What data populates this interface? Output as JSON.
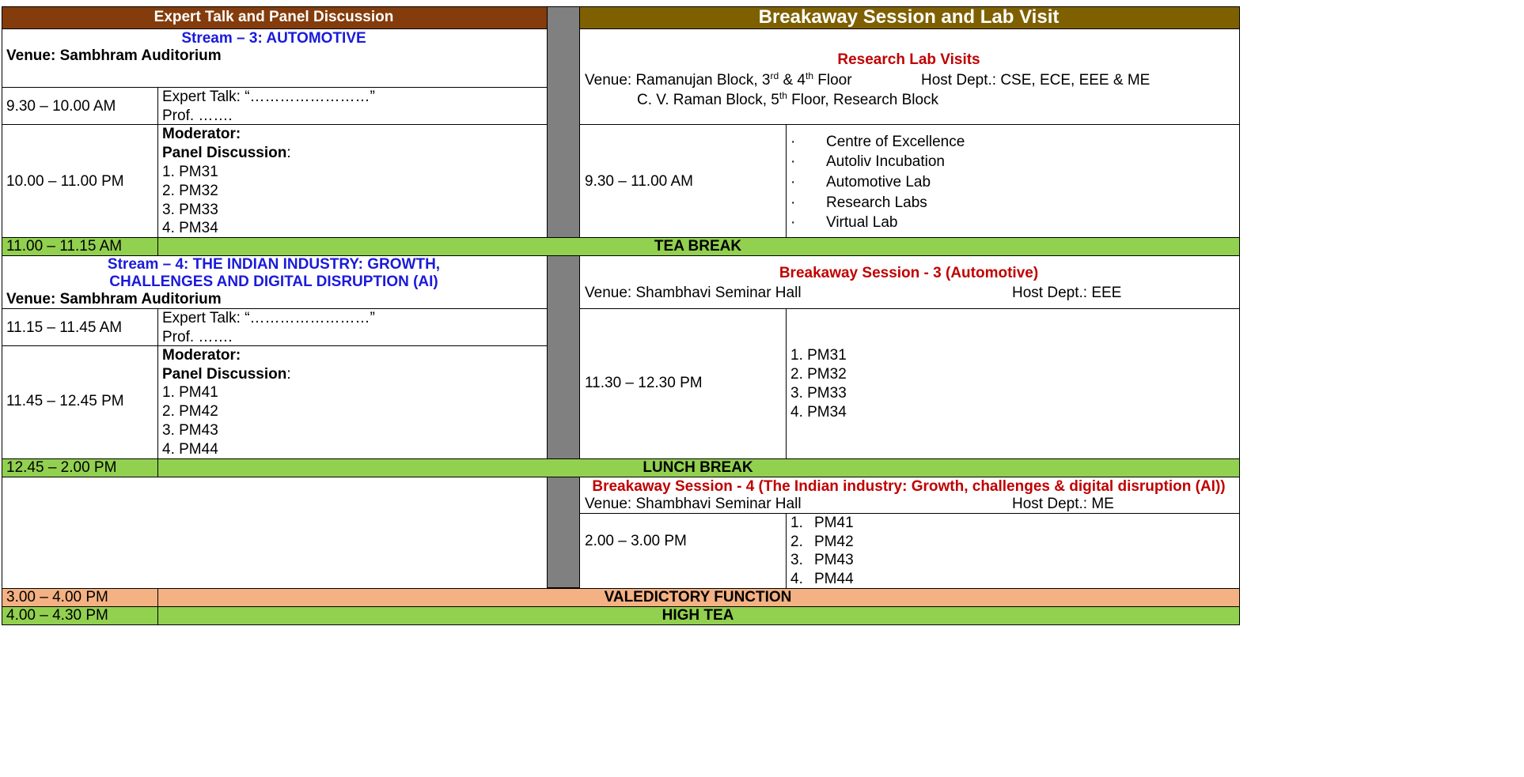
{
  "colors": {
    "left_header_bg": "#843c0c",
    "right_header_bg": "#7f6000",
    "divider_gray": "#808080",
    "break_green": "#92d050",
    "valedictory_orange": "#f4b183",
    "stream_blue": "#1a1adb",
    "session_red": "#c00000"
  },
  "header": {
    "left": "Expert Talk and Panel Discussion",
    "right": "Breakaway Session and Lab Visit"
  },
  "stream3": {
    "title": "Stream – 3: AUTOMOTIVE",
    "venue": "Venue: Sambhram Auditorium",
    "talk_time": "9.30 – 10.00 AM",
    "talk_title": "Expert Talk: “……………………”",
    "talk_prof": "Prof. …….",
    "panel_time": "10.00 – 11.00 PM",
    "moderator": "Moderator:",
    "panel_label": "Panel Discussion",
    "panel_colon": ":",
    "panelists": [
      "1. PM31",
      "2. PM32",
      "3. PM33",
      "4. PM34"
    ]
  },
  "lab_visits": {
    "title": "Research Lab Visits",
    "venue_prefix": "Venue:  Ramanujan Block, 3",
    "sup1": "rd",
    "amp": " & 4",
    "sup2": "th",
    "floor": " Floor",
    "host": "Host Dept.: CSE, ECE, EEE & ME",
    "line2_a": "C. V. Raman Block, 5",
    "line2_sup": "th",
    "line2_b": " Floor, Research Block",
    "time": "9.30 – 11.00 AM",
    "bullet": "·",
    "labs": [
      "Centre of Excellence",
      "Autoliv Incubation",
      "Automotive Lab",
      "Research Labs",
      "Virtual Lab"
    ]
  },
  "tea_break": {
    "time": "11.00 – 11.15 AM",
    "label": "TEA BREAK"
  },
  "stream4": {
    "title_line1": "Stream – 4: THE INDIAN INDUSTRY: GROWTH,",
    "title_line2": "CHALLENGES AND DIGITAL DISRUPTION (AI)",
    "venue": "Venue: Sambhram Auditorium",
    "talk_time": "11.15 – 11.45 AM",
    "talk_title": "Expert Talk: “……………………”",
    "talk_prof": "Prof. …….",
    "panel_time": "11.45 – 12.45 PM",
    "moderator": "Moderator:",
    "panel_label": "Panel Discussion",
    "panel_colon": ":",
    "panelists": [
      "1. PM41",
      "2. PM42",
      "3. PM43",
      "4. PM44"
    ]
  },
  "session3": {
    "title": "Breakaway Session - 3 (Automotive)",
    "venue": "Venue: Shambhavi  Seminar Hall",
    "host": "Host Dept.: EEE",
    "time": "11.30 – 12.30 PM",
    "items": [
      "1. PM31",
      "2. PM32",
      "3. PM33",
      "4. PM34"
    ]
  },
  "lunch_break": {
    "time": "12.45 – 2.00 PM",
    "label": "LUNCH BREAK"
  },
  "session4": {
    "title": "Breakaway Session - 4 (The Indian industry: Growth, challenges & digital disruption (AI))",
    "venue": "Venue: Shambhavi  Seminar Hall",
    "host": "Host Dept.: ME",
    "time": "2.00 – 3.00 PM",
    "item_numbers": [
      "1.",
      "2.",
      "3.",
      "4."
    ],
    "item_names": [
      "PM41",
      "PM42",
      "PM43",
      "PM44"
    ]
  },
  "valedictory": {
    "time": "3.00 – 4.00 PM",
    "label": "VALEDICTORY FUNCTION"
  },
  "high_tea": {
    "time": "4.00 – 4.30 PM",
    "label": "HIGH TEA"
  }
}
